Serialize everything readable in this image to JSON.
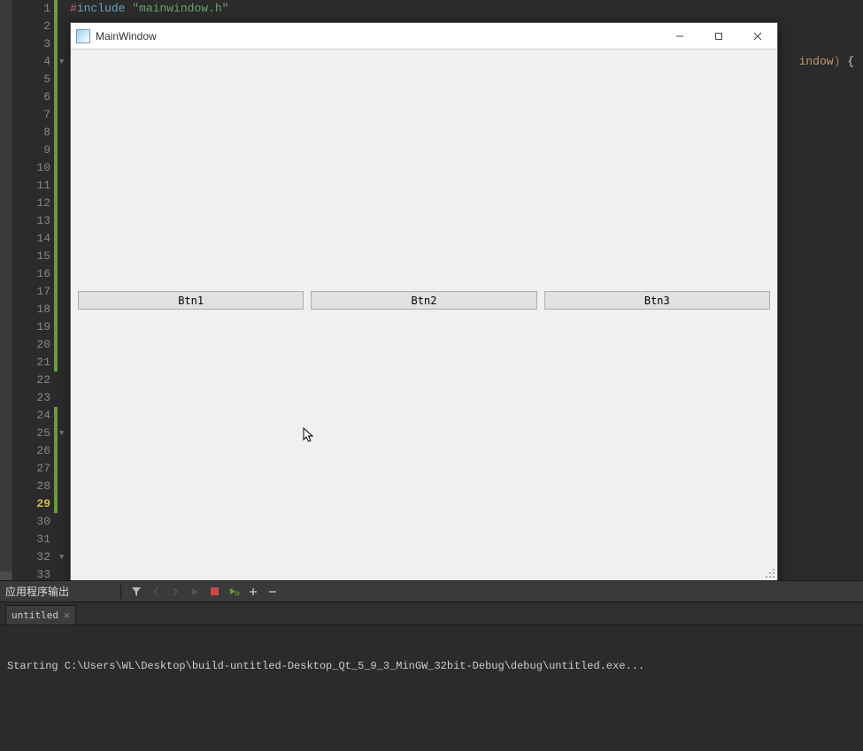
{
  "editor": {
    "line_numbers": [
      "1",
      "2",
      "3",
      "4",
      "5",
      "6",
      "7",
      "8",
      "9",
      "10",
      "11",
      "12",
      "13",
      "14",
      "15",
      "16",
      "17",
      "18",
      "19",
      "20",
      "21",
      "22",
      "23",
      "24",
      "25",
      "26",
      "27",
      "28",
      "29",
      "30",
      "31",
      "32",
      "33"
    ],
    "current_line": "29",
    "code": {
      "line1_pre": "#",
      "line1_inc": "include ",
      "line1_str": "\"mainwindow.h\"",
      "line4_right_id": "indow",
      "line4_right_paren": ")",
      "line4_right_brace": " {"
    }
  },
  "qt_window": {
    "title": "MainWindow",
    "buttons": {
      "b1": "Btn1",
      "b2": "Btn2",
      "b3": "Btn3"
    }
  },
  "output": {
    "panel_title": "应用程序输出",
    "tab_label": "untitled",
    "console_line": "Starting C:\\Users\\WL\\Desktop\\build-untitled-Desktop_Qt_5_9_3_MinGW_32bit-Debug\\debug\\untitled.exe..."
  }
}
